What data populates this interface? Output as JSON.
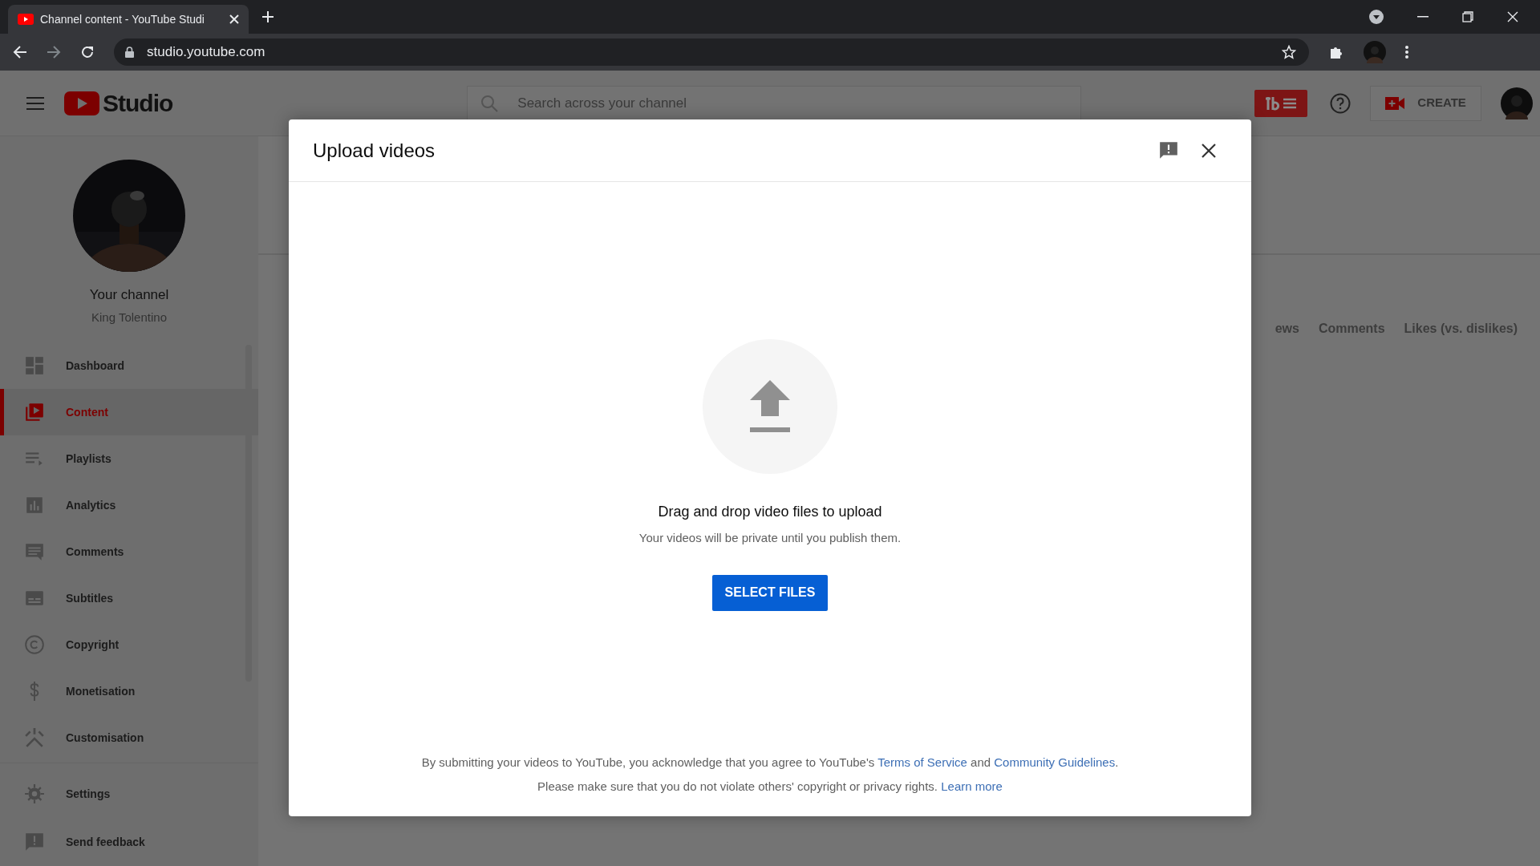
{
  "browser": {
    "tab_title": "Channel content - YouTube Studi",
    "url": "studio.youtube.com"
  },
  "header": {
    "logo_text": "Studio",
    "search_placeholder": "Search across your channel",
    "create_label": "CREATE"
  },
  "channel": {
    "label": "Your channel",
    "name": "King Tolentino"
  },
  "sidebar": {
    "items": [
      {
        "label": "Dashboard",
        "selected": false
      },
      {
        "label": "Content",
        "selected": true
      },
      {
        "label": "Playlists",
        "selected": false
      },
      {
        "label": "Analytics",
        "selected": false
      },
      {
        "label": "Comments",
        "selected": false
      },
      {
        "label": "Subtitles",
        "selected": false
      },
      {
        "label": "Copyright",
        "selected": false
      },
      {
        "label": "Monetisation",
        "selected": false
      },
      {
        "label": "Customisation",
        "selected": false
      }
    ],
    "footer": [
      {
        "label": "Settings"
      },
      {
        "label": "Send feedback"
      }
    ]
  },
  "background_columns": [
    "ews",
    "Comments",
    "Likes (vs. dislikes)"
  ],
  "dialog": {
    "title": "Upload videos",
    "prompt": "Drag and drop video files to upload",
    "subtext": "Your videos will be private until you publish them.",
    "button": "SELECT FILES",
    "legal": [
      {
        "parts": [
          {
            "kind": "text",
            "text": "By submitting your videos to YouTube, you acknowledge that you agree to YouTube's "
          },
          {
            "kind": "link",
            "text": "Terms of Service"
          },
          {
            "kind": "text",
            "text": " and "
          },
          {
            "kind": "link",
            "text": "Community Guidelines"
          },
          {
            "kind": "text",
            "text": "."
          }
        ]
      },
      {
        "parts": [
          {
            "kind": "text",
            "text": "Please make sure that you do not violate others' copyright or privacy rights. "
          },
          {
            "kind": "link",
            "text": "Learn more"
          }
        ]
      }
    ]
  }
}
